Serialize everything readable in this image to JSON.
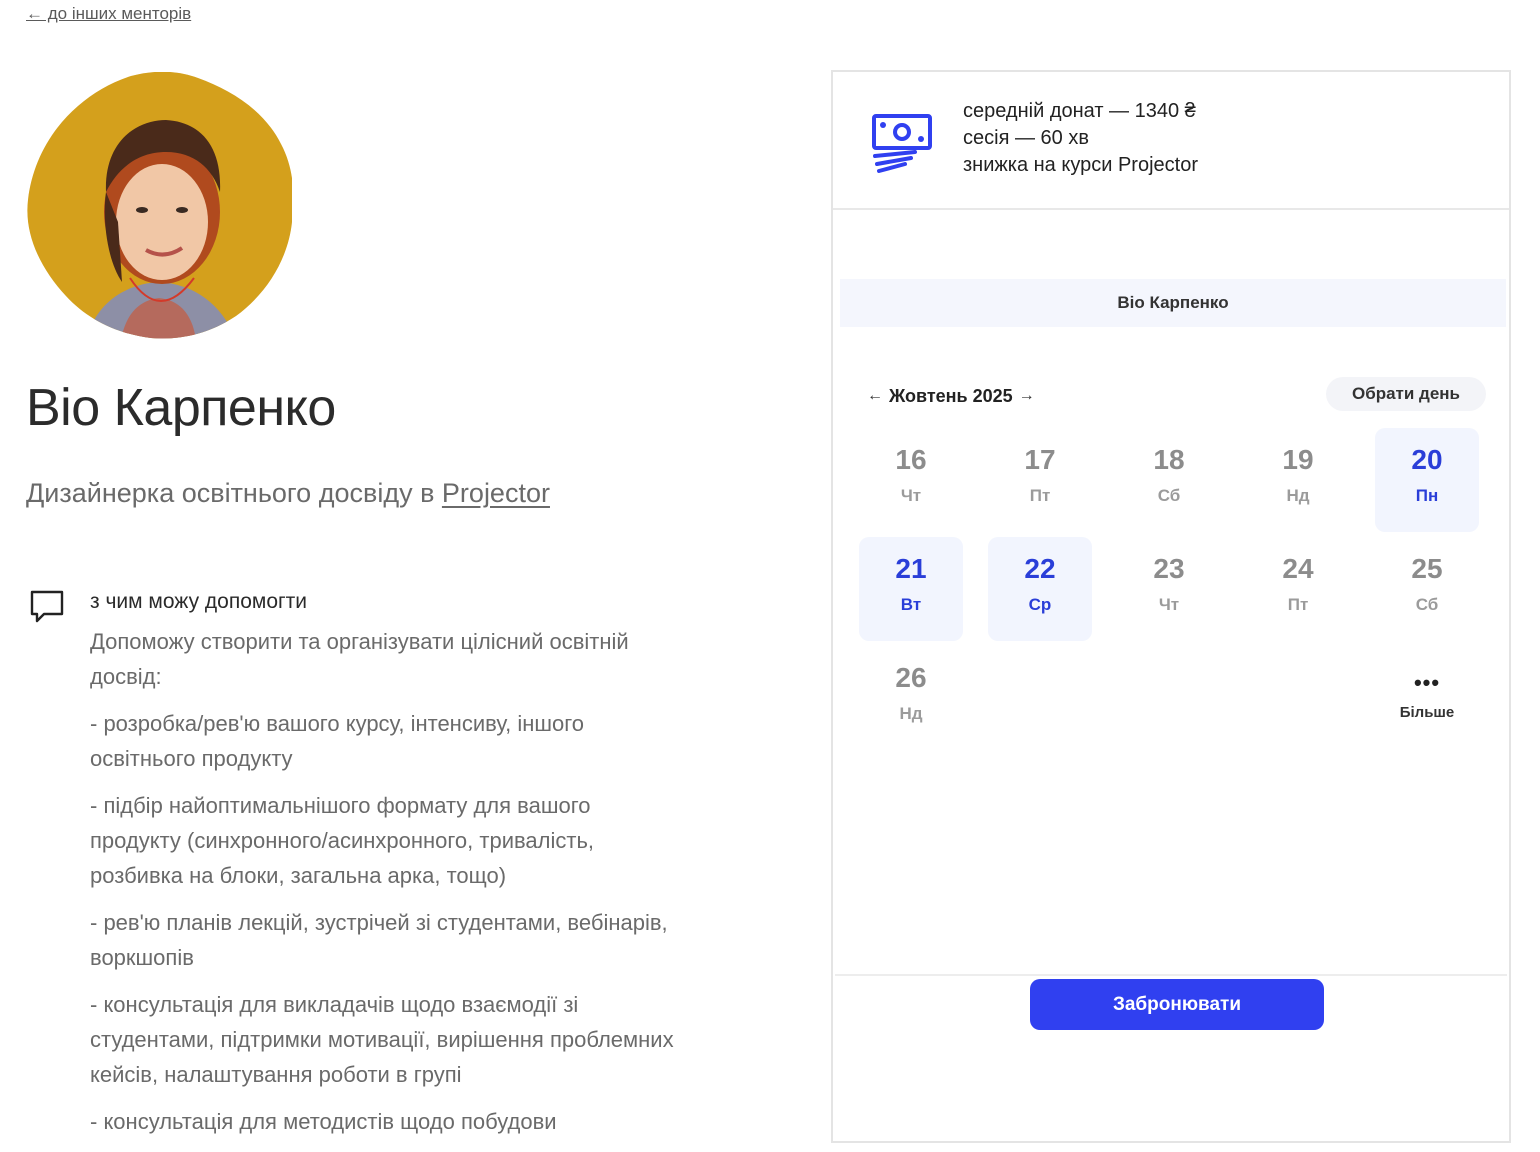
{
  "nav": {
    "back_label": "← до інших менторів"
  },
  "mentor": {
    "name": "Віо Карпенко",
    "role_prefix": "Дизайнерка освітнього досвіду в ",
    "company": "Projector",
    "avatar_bg": "#d9a51f"
  },
  "help": {
    "title": "з чим можу допомогти",
    "paragraphs": [
      "Допоможу створити та організувати цілісний освітній досвід:",
      "- розробка/рев'ю вашого курсу, інтенсиву, іншого освітнього продукту",
      "- підбір найоптимальнішого формату для вашого продукту (синхронного/асинхронного, тривалість, розбивка на блоки, загальна арка, тощо)",
      "- рев'ю планів лекцій, зустрічей зі студентами, вебінарів, воркшопів",
      "- консультація для викладачів щодо взаємодії зі студентами, підтримки мотивації, вирішення проблемних кейсів, налаштування роботи в групі",
      "- консультація для методистів щодо побудови"
    ]
  },
  "booking": {
    "donate_lines": [
      "середній донат — 1340 ₴",
      "сесія — 60 хв",
      "знижка на курси Projector"
    ],
    "widget_title": "Віо Карпенко",
    "month": "Жовтень 2025",
    "choose_day": "Обрати день",
    "days": [
      {
        "num": "16",
        "wd": "Чт",
        "available": false
      },
      {
        "num": "17",
        "wd": "Пт",
        "available": false
      },
      {
        "num": "18",
        "wd": "Сб",
        "available": false
      },
      {
        "num": "19",
        "wd": "Нд",
        "available": false
      },
      {
        "num": "20",
        "wd": "Пн",
        "available": true
      },
      {
        "num": "21",
        "wd": "Вт",
        "available": true
      },
      {
        "num": "22",
        "wd": "Ср",
        "available": true
      },
      {
        "num": "23",
        "wd": "Чт",
        "available": false
      },
      {
        "num": "24",
        "wd": "Пт",
        "available": false
      },
      {
        "num": "25",
        "wd": "Сб",
        "available": false
      },
      {
        "num": "26",
        "wd": "Нд",
        "available": false
      }
    ],
    "more_label": "Більше",
    "book_label": "Забронювати",
    "accent": "#3040f0"
  }
}
